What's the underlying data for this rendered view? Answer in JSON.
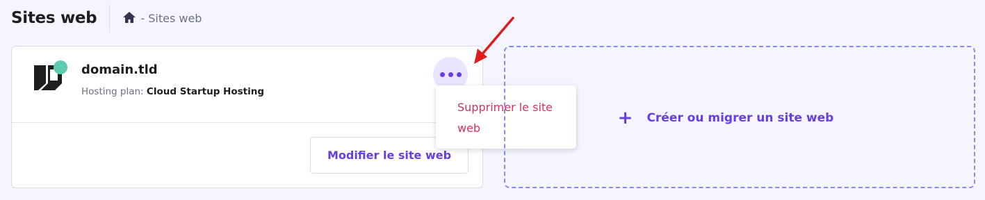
{
  "header": {
    "title": "Sites web",
    "breadcrumb": "- Sites web"
  },
  "site": {
    "name": "domain.tld",
    "plan_label": "Hosting plan:",
    "plan_value": "Cloud Startup Hosting",
    "edit_label": "Modifier le site web",
    "status_color": "#5ecbb0"
  },
  "menu": {
    "items": [
      {
        "label": "Supprimer le site web"
      }
    ]
  },
  "create": {
    "label": "Créer ou migrer un site web"
  },
  "colors": {
    "accent": "#673de6",
    "danger": "#d63163",
    "annotation_arrow": "#e01b1b"
  },
  "icons": {
    "home": "home-icon",
    "more": "more-horizontal-icon",
    "plus": "plus-icon"
  }
}
